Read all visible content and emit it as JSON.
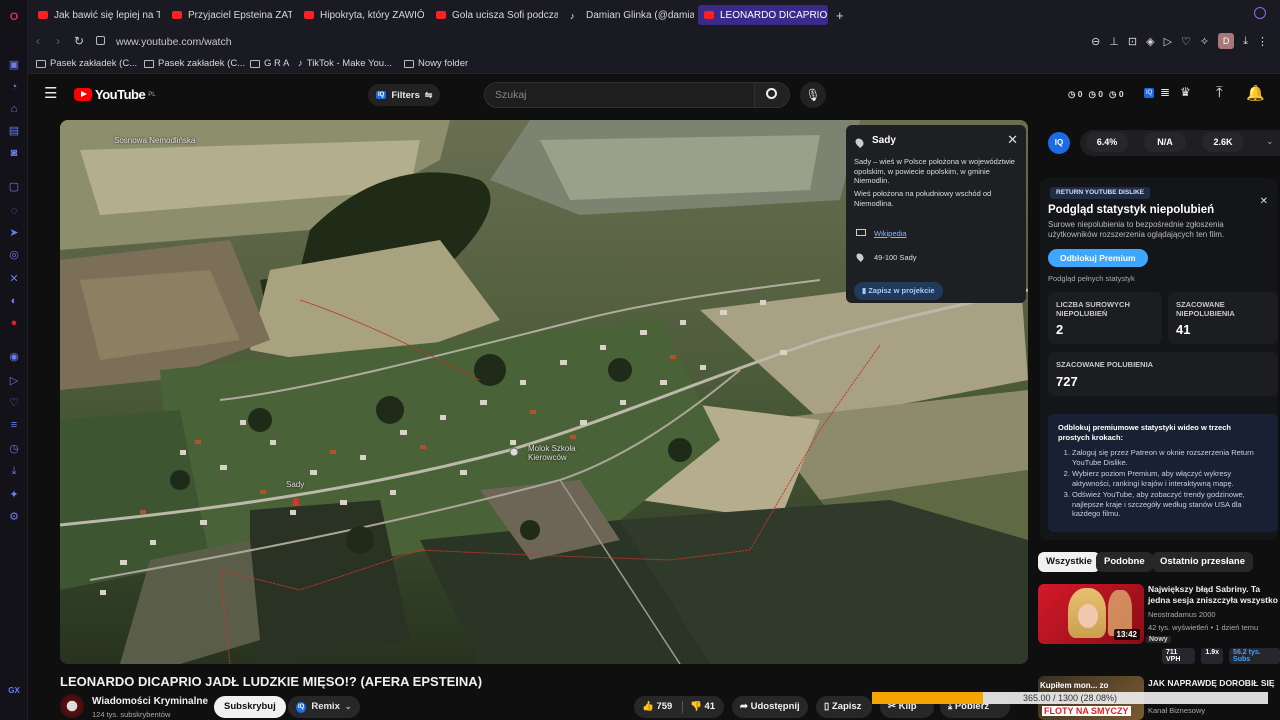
{
  "browser": {
    "tabs": [
      {
        "label": "Jak bawić się lepiej na TR",
        "icon": "youtube-icon"
      },
      {
        "label": "Przyjaciel Epsteina ZATRZ",
        "icon": "youtube-icon"
      },
      {
        "label": "Hipokryta, który ZAWIÓDŁ",
        "icon": "youtube-icon"
      },
      {
        "label": "Gola ucisza Sofi podczas",
        "icon": "youtube-icon"
      },
      {
        "label": "Damian Glinka (@damian_",
        "icon": "tiktok-icon"
      },
      {
        "label": "LEONARDO DICAPRIO JAD",
        "icon": "youtube-icon",
        "active": true
      }
    ],
    "new_tab": "+",
    "url": "www.youtube.com/watch",
    "profile_initial": "D",
    "bookmarks": [
      {
        "label": "Pasek zakładek (C...",
        "icon": "folder-icon"
      },
      {
        "label": "Pasek zakładek (C...",
        "icon": "folder-icon"
      },
      {
        "label": "G R A",
        "icon": "folder-icon"
      },
      {
        "label": "TikTok - Make You...",
        "icon": "tiktok-icon"
      },
      {
        "label": "Nowy folder",
        "icon": "folder-icon"
      }
    ],
    "sidebar_bottom_label": "GX"
  },
  "youtube": {
    "logo_text": "YouTube",
    "logo_region": "PL",
    "filters_label": "Filters",
    "search_placeholder": "Szukaj",
    "header_counters": [
      "0",
      "0",
      "0"
    ]
  },
  "video": {
    "title": "LEONARDO DICAPRIO JADŁ LUDZKIE MIĘSO!? (AFERA EPSTEINA)",
    "channel": "Wiadomości Kryminalne",
    "subscribers": "124 tys. subskrybentów",
    "subscribe_label": "Subskrybuj",
    "remix_label": "Remix",
    "likes": "759",
    "dislikes": "41",
    "share_label": "Udostępnij",
    "save_label": "Zapisz",
    "clip_label": "Klip",
    "download_label": "Pobierz",
    "download_progress_text": "365.00 / 1300 (28.08%)",
    "download_progress": 0.2808
  },
  "map": {
    "labels": [
      "Sosnowa Nemodlińska",
      "Sady",
      "Molok Szkoła Kierowców"
    ],
    "card": {
      "title": "Sady",
      "description": "Sady – wieś w Polsce położona w województwie opolskim, w powiecie opolskim, w gminie Niemodlin.",
      "description2": "Wieś położona na południowy wschód od Niemodlina.",
      "link": "Wikipedia",
      "postal": "49-100 Sady",
      "save_button": "Zapisz w projekcie"
    }
  },
  "iq_bar": {
    "badge": "IQ",
    "stats": [
      "6.4%",
      "N/A",
      "2.6K"
    ]
  },
  "ryd": {
    "badge": "RETURN YOUTUBE DISLIKE",
    "heading": "Podgląd statystyk niepolubień",
    "subtext": "Surowe niepolubienia to bezpośrednie zgłoszenia użytkowników rozszerzenia oglądających ten film.",
    "unlock_button": "Odblokuj Premium",
    "full_stats_link": "Podgląd pełnych statystyk",
    "stats": [
      {
        "label": "LICZBA SUROWYCH NIEPOLUBIEŃ",
        "value": "2"
      },
      {
        "label": "SZACOWANE NIEPOLUBIENIA",
        "value": "41"
      },
      {
        "label": "SZACOWANE POLUBIENIA",
        "value": "727"
      }
    ],
    "premium_heading": "Odblokuj premiumowe statystyki wideo w trzech prostych krokach:",
    "steps": [
      "Zaloguj się przez Patreon w oknie rozszerzenia Return YouTube Dislike.",
      "Wybierz poziom Premium, aby włączyć wykresy aktywności, rankingi krajów i interaktywną mapę.",
      "Odśwież YouTube, aby zobaczyć trendy godzinowe, najlepsze kraje i szczegóły według stanów USA dla każdego filmu."
    ]
  },
  "chips": [
    "Wszystkie",
    "Podobne",
    "Ostatnio przesłane"
  ],
  "recommendations": [
    {
      "title": "Największy błąd Sabriny. Ta jedna sesja zniszczyła wszystko",
      "channel": "Neostradamus 2000",
      "meta": "42 tys. wyświetleń • 1 dzień temu",
      "badge": "Nowy",
      "duration": "13:42",
      "stats": [
        "711 VPH",
        "1.9x",
        "56.2 tys. Subs"
      ]
    },
    {
      "title": "JAK NAPRAWDĘ DOROBIŁ SIĘ",
      "channel": "Kanał Biznesowy",
      "thumb_text": "Kupiłem mon... zo",
      "thumb_text2": "FLOTY NA SMYCZY"
    }
  ],
  "colors": {
    "accent_purple": "#3a2a8a",
    "youtube_red": "#ff0000",
    "ryd_blue": "#3ea6ff",
    "progress_orange": "#f5a400"
  }
}
